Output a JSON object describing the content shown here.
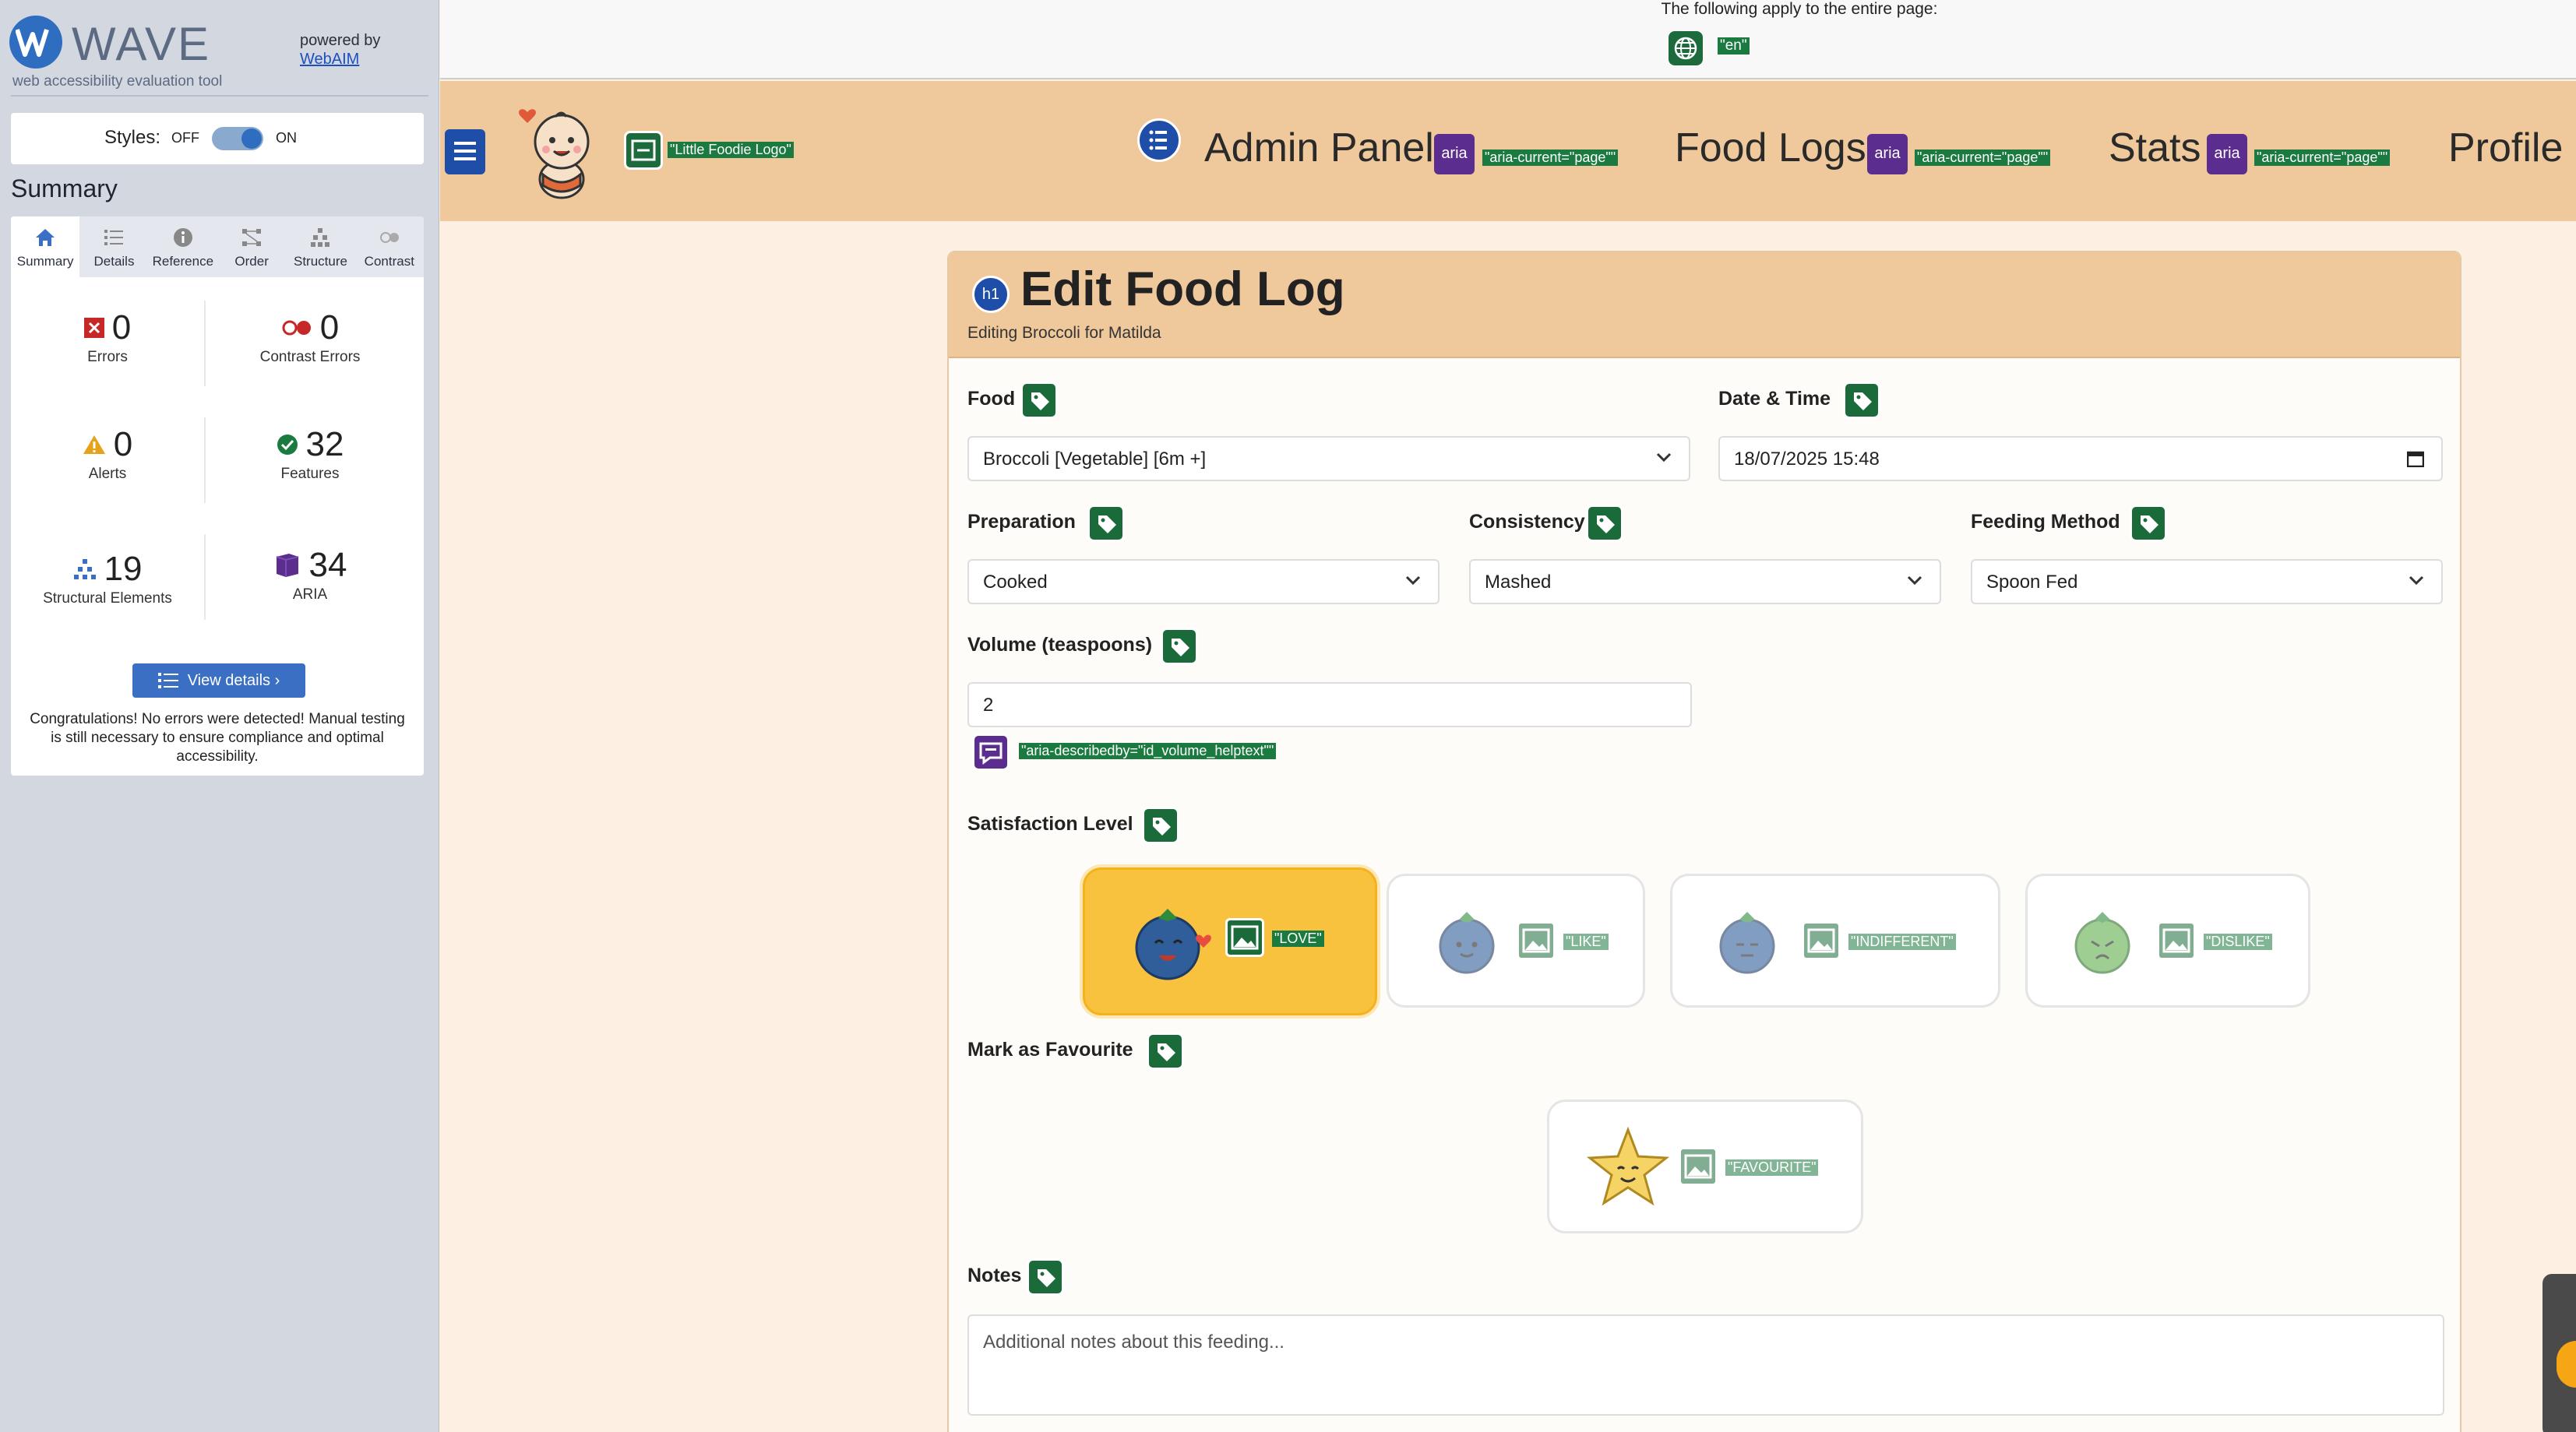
{
  "wave": {
    "title": "WAVE",
    "subtitle": "web accessibility evaluation tool",
    "powered_by": "powered by",
    "webaim": "WebAIM",
    "styles_label": "Styles:",
    "styles_off": "OFF",
    "styles_on": "ON",
    "summary_heading": "Summary",
    "tabs": [
      {
        "label": "Summary",
        "icon": "home-icon"
      },
      {
        "label": "Details",
        "icon": "list-icon"
      },
      {
        "label": "Reference",
        "icon": "info-icon"
      },
      {
        "label": "Order",
        "icon": "order-icon"
      },
      {
        "label": "Structure",
        "icon": "structure-icon"
      },
      {
        "label": "Contrast",
        "icon": "contrast-icon"
      }
    ],
    "stats": {
      "errors": {
        "value": "0",
        "label": "Errors"
      },
      "contrast_errors": {
        "value": "0",
        "label": "Contrast Errors"
      },
      "alerts": {
        "value": "0",
        "label": "Alerts"
      },
      "features": {
        "value": "32",
        "label": "Features"
      },
      "structural": {
        "value": "19",
        "label": "Structural Elements"
      },
      "aria": {
        "value": "34",
        "label": "ARIA"
      }
    },
    "view_details": "View details ›",
    "congrats": "Congratulations! No errors were detected! Manual testing is still necessary to ensure compliance and optimal accessibility."
  },
  "page_level": {
    "text": "The following apply to the entire page:",
    "lang_tag": "\"en\""
  },
  "nav": {
    "logo_tag": "\"Little Foodie Logo\"",
    "items": [
      {
        "label": "Admin Panel",
        "aria_badge": "aria",
        "aria_tag": "\"aria-current=\"page\"\""
      },
      {
        "label": "Food Logs",
        "aria_badge": "aria",
        "aria_tag": "\"aria-current=\"page\"\""
      },
      {
        "label": "Stats",
        "aria_badge": "aria",
        "aria_tag": "\"aria-current=\"page\"\""
      },
      {
        "label": "Profile"
      }
    ]
  },
  "card": {
    "h1_badge": "h1",
    "title": "Edit Food Log",
    "subtitle": "Editing Broccoli for Matilda",
    "food": {
      "label": "Food",
      "value": "Broccoli [Vegetable] [6m +]"
    },
    "datetime": {
      "label": "Date & Time",
      "value": "18/07/2025 15:48"
    },
    "preparation": {
      "label": "Preparation",
      "value": "Cooked"
    },
    "consistency": {
      "label": "Consistency",
      "value": "Mashed"
    },
    "feeding_method": {
      "label": "Feeding Method",
      "value": "Spoon Fed"
    },
    "volume": {
      "label": "Volume (teaspoons)",
      "value": "2",
      "help_tag": "\"aria-describedby=\"id_volume_helptext\"\""
    },
    "satisfaction": {
      "label": "Satisfaction Level",
      "options": [
        {
          "tag": "\"LOVE\"",
          "selected": true
        },
        {
          "tag": "\"LIKE\"",
          "selected": false
        },
        {
          "tag": "\"INDIFFERENT\"",
          "selected": false
        },
        {
          "tag": "\"DISLIKE\"",
          "selected": false
        }
      ]
    },
    "favourite": {
      "label": "Mark as Favourite",
      "tag": "\"FAVOURITE\""
    },
    "notes": {
      "label": "Notes",
      "placeholder": "Additional notes about this feeding..."
    }
  },
  "colors": {
    "nav_bg": "#efc99c",
    "page_bg": "#fdf0e2",
    "selected_option": "#f8c23e",
    "wave_blue": "#2f6dc0",
    "wave_green_tag": "#1b7a3f",
    "aria_purple": "#5b2d8e"
  }
}
